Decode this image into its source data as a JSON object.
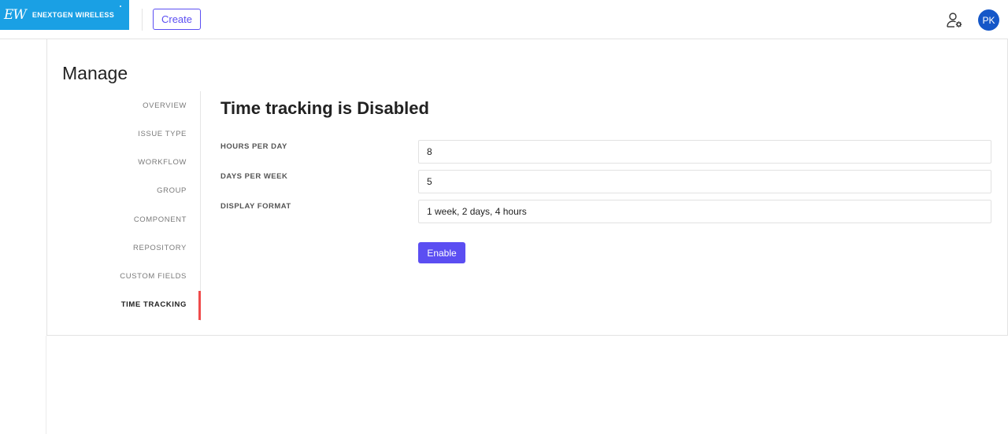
{
  "header": {
    "logo_mark": "EW",
    "logo_text": "ENEXTGEN WIRELESS",
    "create_label": "Create",
    "avatar_initials": "PK",
    "user_settings_icon": "user-gear-icon"
  },
  "page": {
    "title": "Manage"
  },
  "sidebar": {
    "items": [
      {
        "label": "OVERVIEW",
        "active": false
      },
      {
        "label": "ISSUE TYPE",
        "active": false
      },
      {
        "label": "WORKFLOW",
        "active": false
      },
      {
        "label": "GROUP",
        "active": false
      },
      {
        "label": "COMPONENT",
        "active": false
      },
      {
        "label": "REPOSITORY",
        "active": false
      },
      {
        "label": "CUSTOM FIELDS",
        "active": false
      },
      {
        "label": "TIME TRACKING",
        "active": true
      }
    ]
  },
  "time_tracking": {
    "title": "Time tracking is Disabled",
    "fields": [
      {
        "label": "HOURS PER DAY",
        "value": "8"
      },
      {
        "label": "DAYS PER WEEK",
        "value": "5"
      },
      {
        "label": "DISPLAY FORMAT",
        "value": "1 week, 2 days, 4 hours"
      }
    ],
    "enable_label": "Enable"
  },
  "colors": {
    "accent": "#5b4ef2",
    "active_indicator": "#ef4b4b",
    "avatar_bg": "#1557c8",
    "logo_bg": "#1aa0e4"
  }
}
